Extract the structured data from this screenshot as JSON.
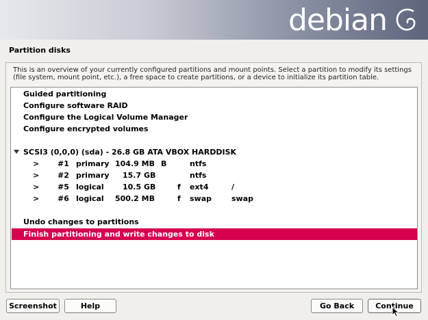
{
  "header": {
    "logo": "debian"
  },
  "page": {
    "title": "Partition disks",
    "description": "This is an overview of your currently configured partitions and mount points. Select a partition to modify its settings (file system, mount point, etc.), a free space to create partitions, or a device to initialize its partition table."
  },
  "menu": {
    "guided": "Guided partitioning",
    "raid": "Configure software RAID",
    "lvm": "Configure the Logical Volume Manager",
    "encrypted": "Configure encrypted volumes",
    "disk": "SCSI3 (0,0,0) (sda) - 26.8 GB ATA VBOX HARDDISK",
    "undo": "Undo changes to partitions",
    "finish": "Finish partitioning and write changes to disk"
  },
  "partitions": [
    {
      "arrow": ">",
      "num": "#1",
      "type": "primary",
      "size": "104.9 MB",
      "flag1": "B",
      "flag2": "",
      "fs": "ntfs",
      "mount": ""
    },
    {
      "arrow": ">",
      "num": "#2",
      "type": "primary",
      "size": "15.7 GB",
      "flag1": "",
      "flag2": "",
      "fs": "ntfs",
      "mount": ""
    },
    {
      "arrow": ">",
      "num": "#5",
      "type": "logical",
      "size": "10.5 GB",
      "flag1": "",
      "flag2": "f",
      "fs": "ext4",
      "mount": "/"
    },
    {
      "arrow": ">",
      "num": "#6",
      "type": "logical",
      "size": "500.2 MB",
      "flag1": "",
      "flag2": "f",
      "fs": "swap",
      "mount": "swap"
    }
  ],
  "buttons": {
    "screenshot": "Screenshot",
    "help": "Help",
    "go_back": "Go Back",
    "continue": "Continue"
  },
  "colors": {
    "selection": "#d6004f"
  }
}
